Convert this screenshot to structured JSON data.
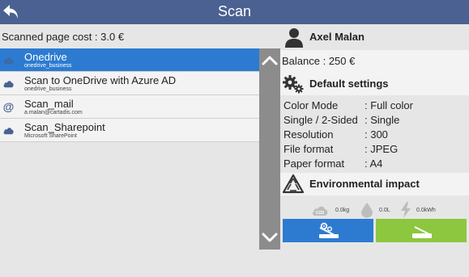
{
  "header": {
    "title": "Scan"
  },
  "scanned_page_cost": "Scanned page cost : 3.0 €",
  "destinations": [
    {
      "title": "Onedrive",
      "subtitle": "onedrive_business",
      "icon": "cloud-icon",
      "selected": true
    },
    {
      "title": "Scan to OneDrive with Azure AD",
      "subtitle": "onedrive_business",
      "icon": "cloud-icon",
      "selected": false
    },
    {
      "title": "Scan_mail",
      "subtitle": "a.malan@cartadis.com",
      "icon": "at-sign-icon",
      "selected": false
    },
    {
      "title": "Scan_Sharepoint",
      "subtitle": "Microsoft SharePoint",
      "icon": "cloud-icon",
      "selected": false
    }
  ],
  "user": {
    "name": "Axel Malan",
    "balance": "Balance : 250 €"
  },
  "default_settings": {
    "title": "Default settings",
    "items": [
      {
        "label": "Color Mode",
        "value": ": Full color"
      },
      {
        "label": "Single / 2-Sided",
        "value": ": Single"
      },
      {
        "label": "Resolution",
        "value": ": 300"
      },
      {
        "label": "File format",
        "value": ": JPEG"
      },
      {
        "label": "Paper format",
        "value": ": A4"
      }
    ]
  },
  "environmental_impact": {
    "title": "Environmental impact",
    "co2": "0.0kg",
    "water": "0.0L",
    "energy": "0.0kWh"
  },
  "colors": {
    "header": "#4a6191",
    "selected": "#2d7bd1",
    "scan_settings_button": "#2d7bd1",
    "start_scan_button": "#8dc63f",
    "scrollbar": "#8c8c8c"
  },
  "icons": {
    "back": "back-arrow-icon",
    "user": "user-icon",
    "settings": "gears-icon",
    "environment": "recycle-warning-icon",
    "scroll_up": "chevron-up-icon",
    "scroll_down": "chevron-down-icon"
  }
}
